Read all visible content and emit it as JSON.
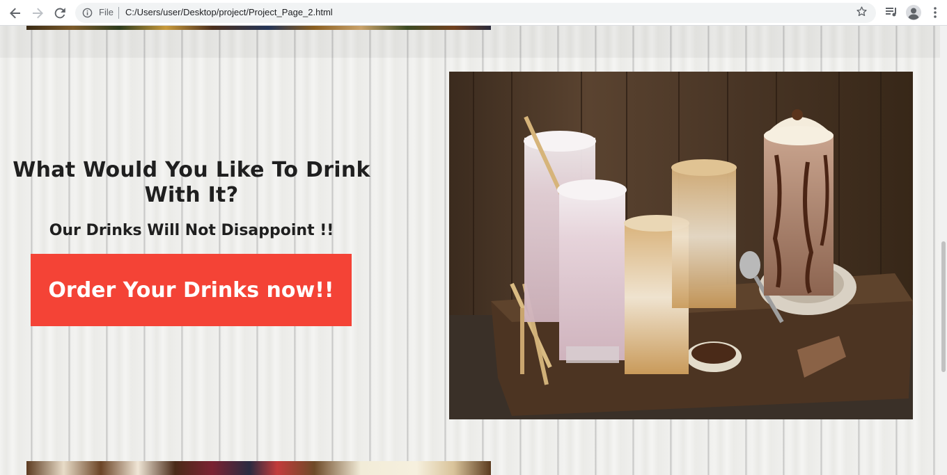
{
  "browser": {
    "back_icon": "arrow-left-icon",
    "forward_icon": "arrow-right-icon",
    "reload_icon": "reload-icon",
    "site_info_icon": "info-circle-icon",
    "scheme_label": "File",
    "url": "C:/Users/user/Desktop/project/Project_Page_2.html",
    "bookmark_icon": "star-icon",
    "media_icon": "playlist-icon",
    "profile_icon": "avatar-icon",
    "menu_icon": "kebab-menu-icon"
  },
  "section": {
    "headline": "What Would You Like To Drink With It?",
    "subheadline": "Our Drinks Will Not Disappoint !!",
    "cta_label": "Order Your Drinks now!!",
    "cta_color": "#f44336",
    "image_subject": "drinks-photo"
  },
  "colors": {
    "text": "#1f1f1f",
    "page_background": "#eeeeec",
    "button_text": "#ffffff"
  }
}
